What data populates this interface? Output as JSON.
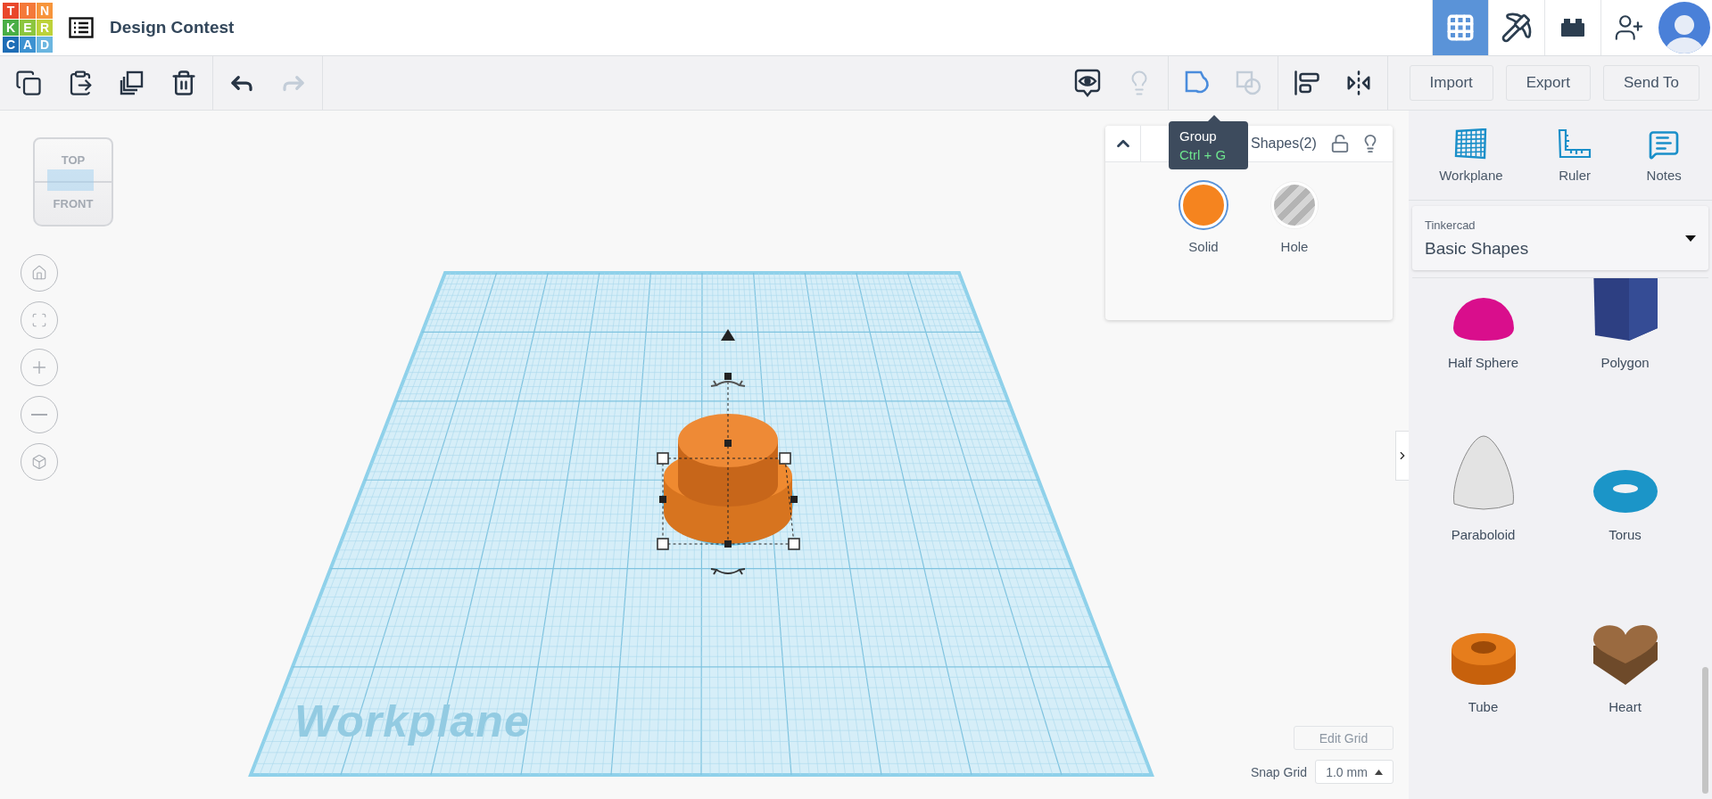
{
  "header": {
    "logo": [
      {
        "letter": "T",
        "color": "#e9472b"
      },
      {
        "letter": "I",
        "color": "#f4793a"
      },
      {
        "letter": "N",
        "color": "#f7953c"
      },
      {
        "letter": "K",
        "color": "#4aae46"
      },
      {
        "letter": "E",
        "color": "#8cc63f"
      },
      {
        "letter": "R",
        "color": "#bdd23a"
      },
      {
        "letter": "C",
        "color": "#1e6db6"
      },
      {
        "letter": "A",
        "color": "#3d92d1"
      },
      {
        "letter": "D",
        "color": "#6bb6e0"
      }
    ],
    "title": "Design Contest",
    "views": [
      {
        "kind": "grid",
        "selected": true
      },
      {
        "kind": "pickaxe",
        "selected": false
      },
      {
        "kind": "bricks",
        "selected": false
      }
    ]
  },
  "toolbar": {
    "edit_tools": [
      {
        "kind": "copy",
        "disabled": false
      },
      {
        "kind": "paste",
        "disabled": false
      },
      {
        "kind": "duplicate",
        "disabled": false
      },
      {
        "kind": "delete",
        "disabled": false
      }
    ],
    "history": [
      {
        "kind": "undo",
        "disabled": false
      },
      {
        "kind": "redo",
        "disabled": true
      }
    ],
    "view_tools": [
      {
        "kind": "notes",
        "disabled": false
      },
      {
        "kind": "lightbulb",
        "disabled": true
      }
    ],
    "group_tools": [
      {
        "kind": "group",
        "disabled": false
      },
      {
        "kind": "ungroup",
        "disabled": true
      }
    ],
    "arrange_tools": [
      {
        "kind": "align",
        "disabled": false
      },
      {
        "kind": "mirror",
        "disabled": false
      }
    ],
    "buttons": [
      "Import",
      "Export",
      "Send To"
    ]
  },
  "tooltip": {
    "title": "Group",
    "shortcut": "Ctrl + G"
  },
  "inspector": {
    "title": "Shapes(2)",
    "expanded": true,
    "locked": false,
    "options": [
      {
        "label": "Solid",
        "kind": "solid",
        "selected": true
      },
      {
        "label": "Hole",
        "kind": "hole",
        "selected": false
      }
    ]
  },
  "view_cube": {
    "top": "TOP",
    "front": "FRONT"
  },
  "canvas": {
    "plane_label": "Workplane",
    "edit_grid": "Edit Grid",
    "snap_grid": {
      "label": "Snap Grid",
      "value": "1.0 mm"
    }
  },
  "sidebar": {
    "tools": [
      {
        "label": "Workplane",
        "kind": "workplane"
      },
      {
        "label": "Ruler",
        "kind": "ruler"
      },
      {
        "label": "Notes",
        "kind": "notes"
      }
    ],
    "library": {
      "label": "Tinkercad",
      "value": "Basic Shapes"
    },
    "shapes": [
      {
        "name": "Half Sphere",
        "kind": "half_sphere"
      },
      {
        "name": "Polygon",
        "kind": "polygon"
      },
      {
        "name": "Paraboloid",
        "kind": "paraboloid"
      },
      {
        "name": "Torus",
        "kind": "torus"
      },
      {
        "name": "Tube",
        "kind": "tube"
      },
      {
        "name": "Heart",
        "kind": "heart"
      }
    ]
  }
}
